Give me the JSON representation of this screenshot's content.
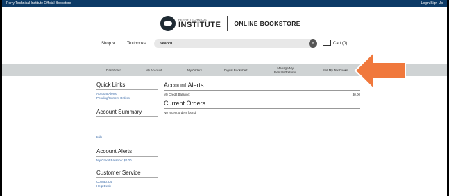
{
  "topbar": {
    "left": "Perry Technical Institute Official Bookstore",
    "right": "Login/Sign Up"
  },
  "logo": {
    "small": "PERRY TECHNICAL",
    "big": "INSTITUTE",
    "store": "ONLINE BOOKSTORE"
  },
  "nav": {
    "shop": "Shop ∨",
    "textbooks": "Textbooks",
    "search_placeholder": "Search",
    "search_icon": "⌕",
    "cart": "Cart (0)"
  },
  "menu": {
    "dashboard": "Dashboard",
    "account": "My Account",
    "orders": "My Orders",
    "bookshelf": "Digital Bookshelf",
    "rentals_line1": "Manage My",
    "rentals_line2": "Rentals/Returns",
    "sell": "Sell My Textbooks"
  },
  "sidebar": {
    "quick_links": "Quick Links",
    "account_alerts_link": "Account Alerts",
    "pending_orders": "Pending/Current Orders",
    "account_summary": "Account Summary",
    "edit": "Edit",
    "account_alerts": "Account Alerts",
    "credit_balance": "My Credit Balance: $0.00",
    "customer_service": "Customer Service",
    "contact_us": "Contact Us",
    "help_desk": "Help Desk"
  },
  "main": {
    "alerts_title": "Account Alerts",
    "credit_label": "My Credit Balance:",
    "credit_value": "$0.00",
    "orders_title": "Current Orders",
    "orders_empty": "No recent orders found."
  },
  "colors": {
    "topbar": "#0c3a66",
    "arrow": "#f0783c",
    "graybar": "#cfd3d4",
    "link": "#3a6aa8"
  }
}
